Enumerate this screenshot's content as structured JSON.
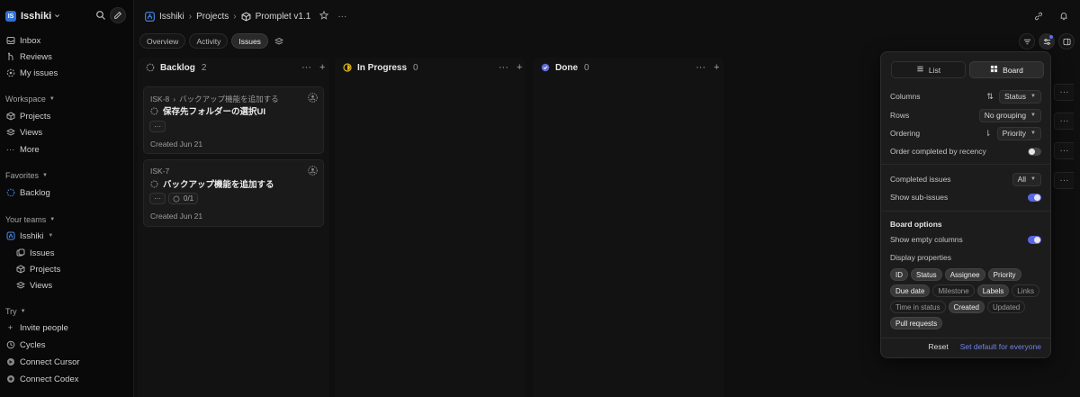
{
  "workspace": {
    "logo": "IS",
    "name": "Isshiki"
  },
  "sidebar": {
    "top_items": [
      {
        "label": "Inbox",
        "icon": "inbox-icon"
      },
      {
        "label": "Reviews",
        "icon": "reviews-icon"
      },
      {
        "label": "My issues",
        "icon": "my-issues-icon"
      }
    ],
    "workspace_section": "Workspace",
    "workspace_items": [
      {
        "label": "Projects",
        "icon": "projects-icon"
      },
      {
        "label": "Views",
        "icon": "views-icon"
      },
      {
        "label": "More",
        "icon": "more-icon"
      }
    ],
    "favorites_section": "Favorites",
    "favorites_items": [
      {
        "label": "Backlog",
        "icon": "backlog-icon"
      }
    ],
    "teams_section": "Your teams",
    "team": {
      "label": "Isshiki"
    },
    "team_items": [
      {
        "label": "Issues",
        "icon": "issues-icon"
      },
      {
        "label": "Projects",
        "icon": "projects-icon"
      },
      {
        "label": "Views",
        "icon": "views-icon"
      }
    ],
    "try_section": "Try",
    "try_items": [
      {
        "label": "Invite people",
        "icon": "plus-icon"
      },
      {
        "label": "Cycles",
        "icon": "cycles-icon"
      },
      {
        "label": "Connect Cursor",
        "icon": "cursor-icon"
      },
      {
        "label": "Connect Codex",
        "icon": "codex-icon"
      }
    ]
  },
  "breadcrumb": {
    "team": "Isshiki",
    "section": "Projects",
    "project": "Promplet v1.1"
  },
  "tabs": [
    {
      "label": "Overview",
      "active": false
    },
    {
      "label": "Activity",
      "active": false
    },
    {
      "label": "Issues",
      "active": true
    }
  ],
  "columns": [
    {
      "name": "Backlog",
      "count": "2"
    },
    {
      "name": "In Progress",
      "count": "0"
    },
    {
      "name": "Done",
      "count": "0"
    }
  ],
  "cards": [
    {
      "id": "ISK-8",
      "parent": "バックアップ機能を追加する",
      "title": "保存先フォルダーの選択UI",
      "chips": [
        "···"
      ],
      "created": "Created Jun 21"
    },
    {
      "id": "ISK-7",
      "parent": "",
      "title": "バックアップ機能を追加する",
      "chips": [
        "···",
        "0/1"
      ],
      "created": "Created Jun 21"
    }
  ],
  "popover": {
    "layout_list": "List",
    "layout_board": "Board",
    "columns_label": "Columns",
    "columns_value": "Status",
    "rows_label": "Rows",
    "rows_value": "No grouping",
    "ordering_label": "Ordering",
    "ordering_value": "Priority",
    "order_recency_label": "Order completed by recency",
    "order_recency_on": false,
    "completed_label": "Completed issues",
    "completed_value": "All",
    "subissues_label": "Show sub-issues",
    "subissues_on": true,
    "board_options_title": "Board options",
    "empty_columns_label": "Show empty columns",
    "empty_columns_on": true,
    "display_properties_title": "Display properties",
    "properties": [
      {
        "label": "ID",
        "on": true
      },
      {
        "label": "Status",
        "on": true
      },
      {
        "label": "Assignee",
        "on": true
      },
      {
        "label": "Priority",
        "on": true
      },
      {
        "label": "Due date",
        "on": true
      },
      {
        "label": "Milestone",
        "on": false
      },
      {
        "label": "Labels",
        "on": true
      },
      {
        "label": "Links",
        "on": false
      },
      {
        "label": "Time in status",
        "on": false
      },
      {
        "label": "Created",
        "on": true
      },
      {
        "label": "Updated",
        "on": false
      },
      {
        "label": "Pull requests",
        "on": true
      }
    ],
    "reset_label": "Reset",
    "set_default_label": "Set default for everyone"
  },
  "colors": {
    "accent": "#5a66e8",
    "link": "#6f83ec",
    "in_progress": "#e2b714",
    "done": "#5e6ad2",
    "logo": "#2f6fd8"
  }
}
